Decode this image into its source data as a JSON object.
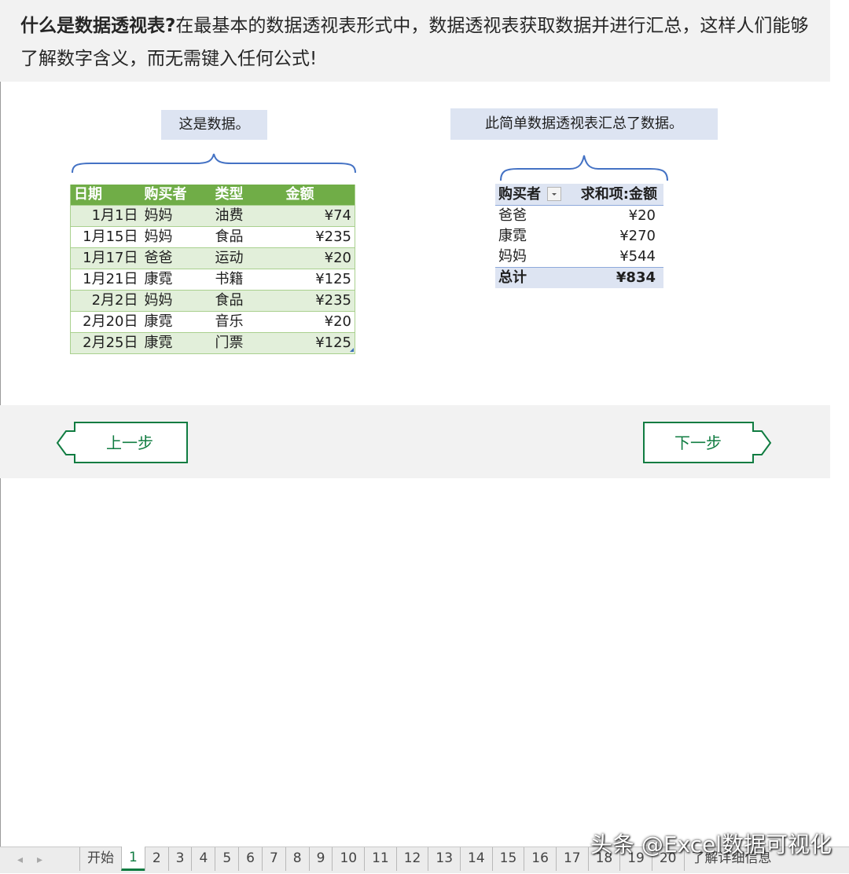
{
  "intro": {
    "title": "什么是数据透视表?",
    "text": "在最基本的数据透视表形式中，数据透视表获取数据并进行汇总，这样人们能够了解数字含义，而无需键入任何公式!"
  },
  "data_caption": "这是数据。",
  "pivot_caption": "此简单数据透视表汇总了数据。",
  "data_table": {
    "headers": [
      "日期",
      "购买者",
      "类型",
      "金额"
    ],
    "rows": [
      [
        "1月1日",
        "妈妈",
        "油费",
        "¥74"
      ],
      [
        "1月15日",
        "妈妈",
        "食品",
        "¥235"
      ],
      [
        "1月17日",
        "爸爸",
        "运动",
        "¥20"
      ],
      [
        "1月21日",
        "康霓",
        "书籍",
        "¥125"
      ],
      [
        "2月2日",
        "妈妈",
        "食品",
        "¥235"
      ],
      [
        "2月20日",
        "康霓",
        "音乐",
        "¥20"
      ],
      [
        "2月25日",
        "康霓",
        "门票",
        "¥125"
      ]
    ]
  },
  "pivot_table": {
    "headers": [
      "购买者",
      "求和项:金额"
    ],
    "rows": [
      [
        "爸爸",
        "¥20"
      ],
      [
        "康霓",
        "¥270"
      ],
      [
        "妈妈",
        "¥544"
      ]
    ],
    "total": [
      "总计",
      "¥834"
    ]
  },
  "nav": {
    "prev_label": "上一步",
    "next_label": "下一步"
  },
  "sheet_tabs": [
    "开始",
    "1",
    "2",
    "3",
    "4",
    "5",
    "6",
    "7",
    "8",
    "9",
    "10",
    "11",
    "12",
    "13",
    "14",
    "15",
    "16",
    "17",
    "18",
    "19",
    "20",
    "了解详细信息"
  ],
  "active_tab": "1",
  "watermark": "头条 @Excel数据可视化",
  "colors": {
    "header_green": "#70ad47",
    "band_green": "#e2efda",
    "pivot_blue": "#dde4f2",
    "accent_green": "#107c41"
  }
}
